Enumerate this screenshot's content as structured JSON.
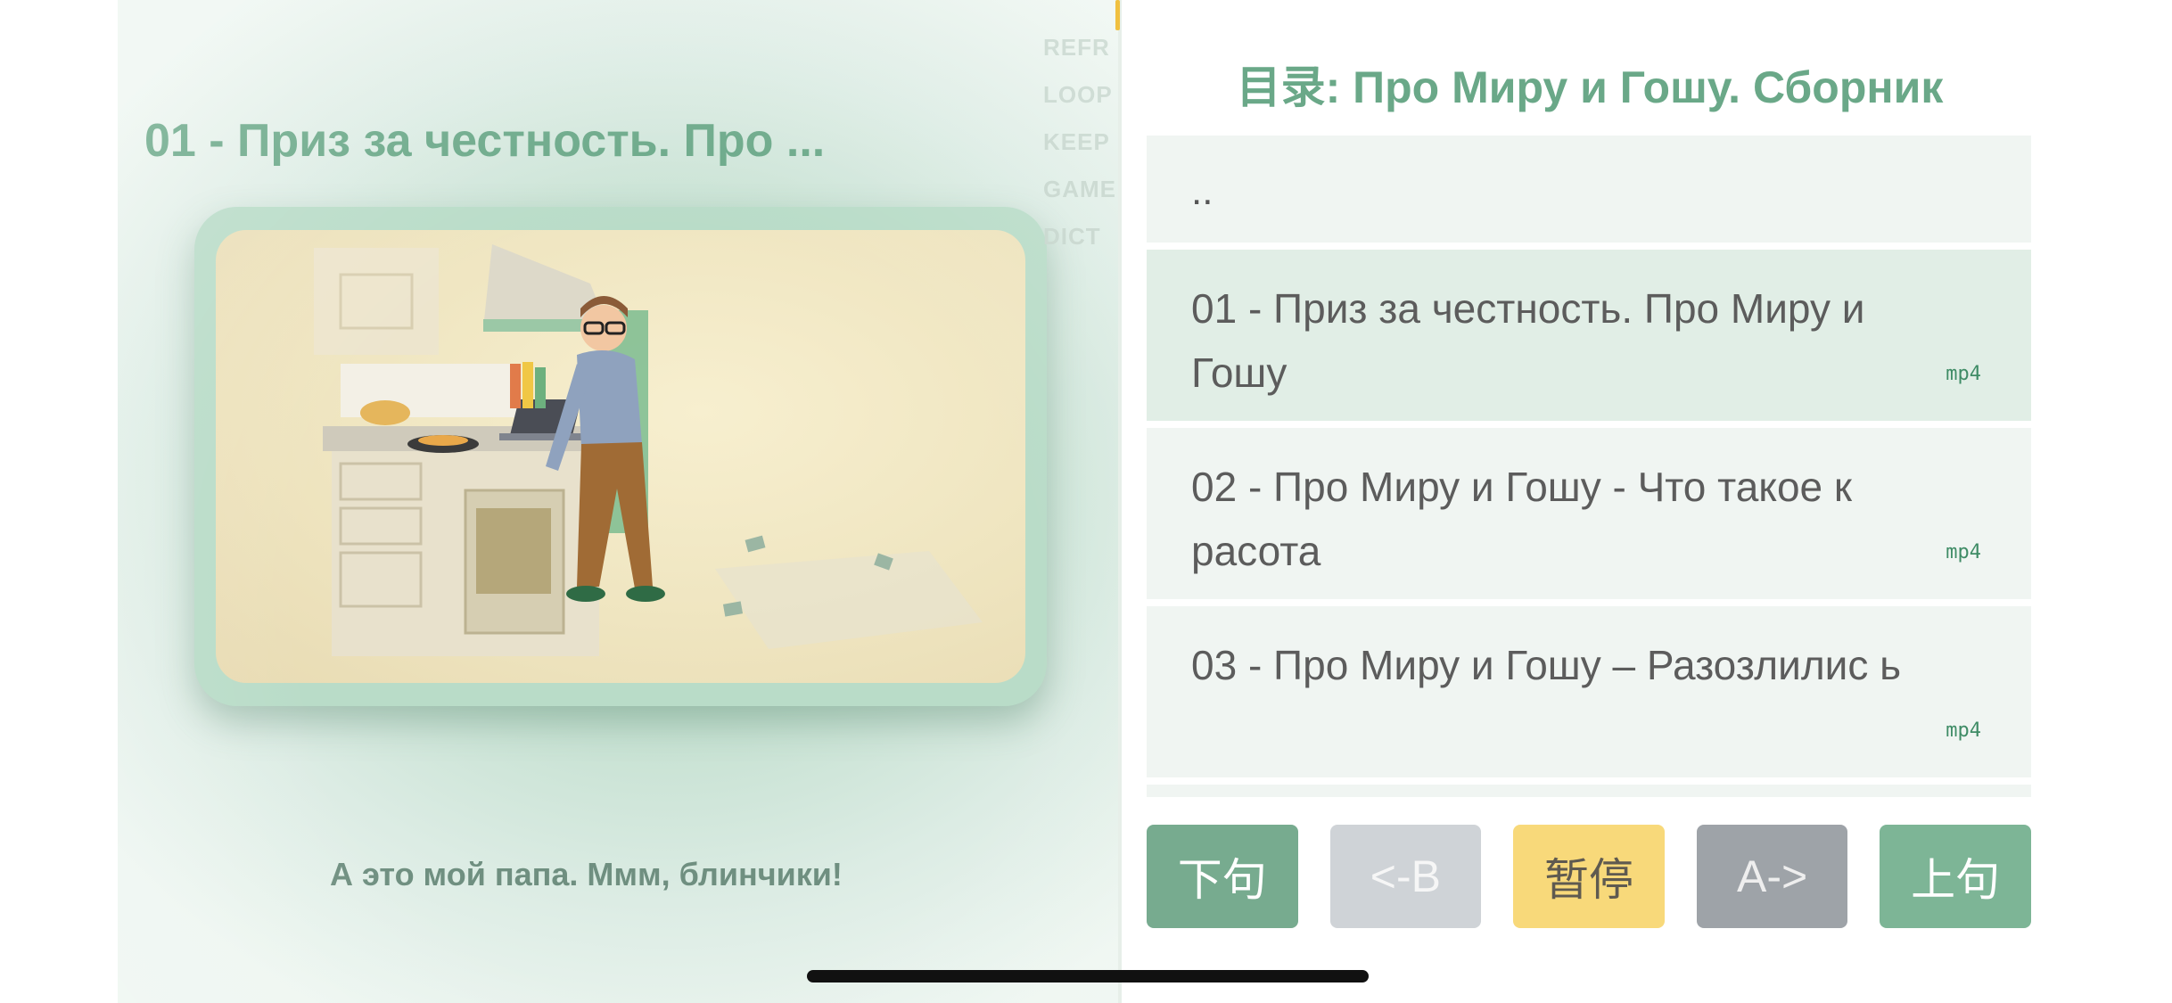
{
  "player": {
    "title": "01 - Приз за честность. Про ...",
    "subtitle": "А это мой папа. Ммм, блинчики!",
    "side_menu": [
      "REFR",
      "LOOP",
      "KEEP",
      "GAME",
      "DICT"
    ]
  },
  "playlist": {
    "title": "目录: Про Миру и Гошу. Сборник",
    "parent_label": "..",
    "items": [
      {
        "label": "01 - Приз за честность. Про Миру и Гошу",
        "ext": "mp4",
        "selected": true
      },
      {
        "label": "02 - Про Миру и Гошу - Что такое к расота",
        "ext": "mp4",
        "selected": false
      },
      {
        "label": "03 - Про Миру и Гошу – Разозлилис ь",
        "ext": "mp4",
        "selected": false
      }
    ]
  },
  "controls": {
    "next": "下句",
    "b_back": "<-B",
    "pause": "暂停",
    "a_forward": "A->",
    "prev": "上句"
  },
  "colors": {
    "accent_green": "#6aa888",
    "button_green": "#77ab8f",
    "button_yellow": "#f8d97a",
    "button_gray": "#9ea3a8"
  }
}
